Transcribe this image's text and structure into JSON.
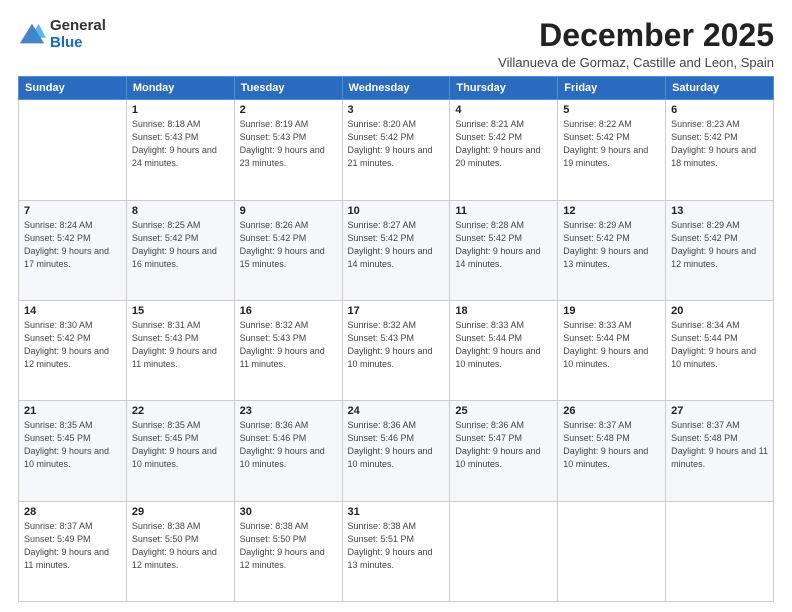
{
  "logo": {
    "general": "General",
    "blue": "Blue"
  },
  "header": {
    "month": "December 2025",
    "location": "Villanueva de Gormaz, Castille and Leon, Spain"
  },
  "weekdays": [
    "Sunday",
    "Monday",
    "Tuesday",
    "Wednesday",
    "Thursday",
    "Friday",
    "Saturday"
  ],
  "weeks": [
    [
      {
        "day": "",
        "sunrise": "",
        "sunset": "",
        "daylight": ""
      },
      {
        "day": "1",
        "sunrise": "Sunrise: 8:18 AM",
        "sunset": "Sunset: 5:43 PM",
        "daylight": "Daylight: 9 hours and 24 minutes."
      },
      {
        "day": "2",
        "sunrise": "Sunrise: 8:19 AM",
        "sunset": "Sunset: 5:43 PM",
        "daylight": "Daylight: 9 hours and 23 minutes."
      },
      {
        "day": "3",
        "sunrise": "Sunrise: 8:20 AM",
        "sunset": "Sunset: 5:42 PM",
        "daylight": "Daylight: 9 hours and 21 minutes."
      },
      {
        "day": "4",
        "sunrise": "Sunrise: 8:21 AM",
        "sunset": "Sunset: 5:42 PM",
        "daylight": "Daylight: 9 hours and 20 minutes."
      },
      {
        "day": "5",
        "sunrise": "Sunrise: 8:22 AM",
        "sunset": "Sunset: 5:42 PM",
        "daylight": "Daylight: 9 hours and 19 minutes."
      },
      {
        "day": "6",
        "sunrise": "Sunrise: 8:23 AM",
        "sunset": "Sunset: 5:42 PM",
        "daylight": "Daylight: 9 hours and 18 minutes."
      }
    ],
    [
      {
        "day": "7",
        "sunrise": "Sunrise: 8:24 AM",
        "sunset": "Sunset: 5:42 PM",
        "daylight": "Daylight: 9 hours and 17 minutes."
      },
      {
        "day": "8",
        "sunrise": "Sunrise: 8:25 AM",
        "sunset": "Sunset: 5:42 PM",
        "daylight": "Daylight: 9 hours and 16 minutes."
      },
      {
        "day": "9",
        "sunrise": "Sunrise: 8:26 AM",
        "sunset": "Sunset: 5:42 PM",
        "daylight": "Daylight: 9 hours and 15 minutes."
      },
      {
        "day": "10",
        "sunrise": "Sunrise: 8:27 AM",
        "sunset": "Sunset: 5:42 PM",
        "daylight": "Daylight: 9 hours and 14 minutes."
      },
      {
        "day": "11",
        "sunrise": "Sunrise: 8:28 AM",
        "sunset": "Sunset: 5:42 PM",
        "daylight": "Daylight: 9 hours and 14 minutes."
      },
      {
        "day": "12",
        "sunrise": "Sunrise: 8:29 AM",
        "sunset": "Sunset: 5:42 PM",
        "daylight": "Daylight: 9 hours and 13 minutes."
      },
      {
        "day": "13",
        "sunrise": "Sunrise: 8:29 AM",
        "sunset": "Sunset: 5:42 PM",
        "daylight": "Daylight: 9 hours and 12 minutes."
      }
    ],
    [
      {
        "day": "14",
        "sunrise": "Sunrise: 8:30 AM",
        "sunset": "Sunset: 5:42 PM",
        "daylight": "Daylight: 9 hours and 12 minutes."
      },
      {
        "day": "15",
        "sunrise": "Sunrise: 8:31 AM",
        "sunset": "Sunset: 5:43 PM",
        "daylight": "Daylight: 9 hours and 11 minutes."
      },
      {
        "day": "16",
        "sunrise": "Sunrise: 8:32 AM",
        "sunset": "Sunset: 5:43 PM",
        "daylight": "Daylight: 9 hours and 11 minutes."
      },
      {
        "day": "17",
        "sunrise": "Sunrise: 8:32 AM",
        "sunset": "Sunset: 5:43 PM",
        "daylight": "Daylight: 9 hours and 10 minutes."
      },
      {
        "day": "18",
        "sunrise": "Sunrise: 8:33 AM",
        "sunset": "Sunset: 5:44 PM",
        "daylight": "Daylight: 9 hours and 10 minutes."
      },
      {
        "day": "19",
        "sunrise": "Sunrise: 8:33 AM",
        "sunset": "Sunset: 5:44 PM",
        "daylight": "Daylight: 9 hours and 10 minutes."
      },
      {
        "day": "20",
        "sunrise": "Sunrise: 8:34 AM",
        "sunset": "Sunset: 5:44 PM",
        "daylight": "Daylight: 9 hours and 10 minutes."
      }
    ],
    [
      {
        "day": "21",
        "sunrise": "Sunrise: 8:35 AM",
        "sunset": "Sunset: 5:45 PM",
        "daylight": "Daylight: 9 hours and 10 minutes."
      },
      {
        "day": "22",
        "sunrise": "Sunrise: 8:35 AM",
        "sunset": "Sunset: 5:45 PM",
        "daylight": "Daylight: 9 hours and 10 minutes."
      },
      {
        "day": "23",
        "sunrise": "Sunrise: 8:36 AM",
        "sunset": "Sunset: 5:46 PM",
        "daylight": "Daylight: 9 hours and 10 minutes."
      },
      {
        "day": "24",
        "sunrise": "Sunrise: 8:36 AM",
        "sunset": "Sunset: 5:46 PM",
        "daylight": "Daylight: 9 hours and 10 minutes."
      },
      {
        "day": "25",
        "sunrise": "Sunrise: 8:36 AM",
        "sunset": "Sunset: 5:47 PM",
        "daylight": "Daylight: 9 hours and 10 minutes."
      },
      {
        "day": "26",
        "sunrise": "Sunrise: 8:37 AM",
        "sunset": "Sunset: 5:48 PM",
        "daylight": "Daylight: 9 hours and 10 minutes."
      },
      {
        "day": "27",
        "sunrise": "Sunrise: 8:37 AM",
        "sunset": "Sunset: 5:48 PM",
        "daylight": "Daylight: 9 hours and 11 minutes."
      }
    ],
    [
      {
        "day": "28",
        "sunrise": "Sunrise: 8:37 AM",
        "sunset": "Sunset: 5:49 PM",
        "daylight": "Daylight: 9 hours and 11 minutes."
      },
      {
        "day": "29",
        "sunrise": "Sunrise: 8:38 AM",
        "sunset": "Sunset: 5:50 PM",
        "daylight": "Daylight: 9 hours and 12 minutes."
      },
      {
        "day": "30",
        "sunrise": "Sunrise: 8:38 AM",
        "sunset": "Sunset: 5:50 PM",
        "daylight": "Daylight: 9 hours and 12 minutes."
      },
      {
        "day": "31",
        "sunrise": "Sunrise: 8:38 AM",
        "sunset": "Sunset: 5:51 PM",
        "daylight": "Daylight: 9 hours and 13 minutes."
      },
      {
        "day": "",
        "sunrise": "",
        "sunset": "",
        "daylight": ""
      },
      {
        "day": "",
        "sunrise": "",
        "sunset": "",
        "daylight": ""
      },
      {
        "day": "",
        "sunrise": "",
        "sunset": "",
        "daylight": ""
      }
    ]
  ]
}
